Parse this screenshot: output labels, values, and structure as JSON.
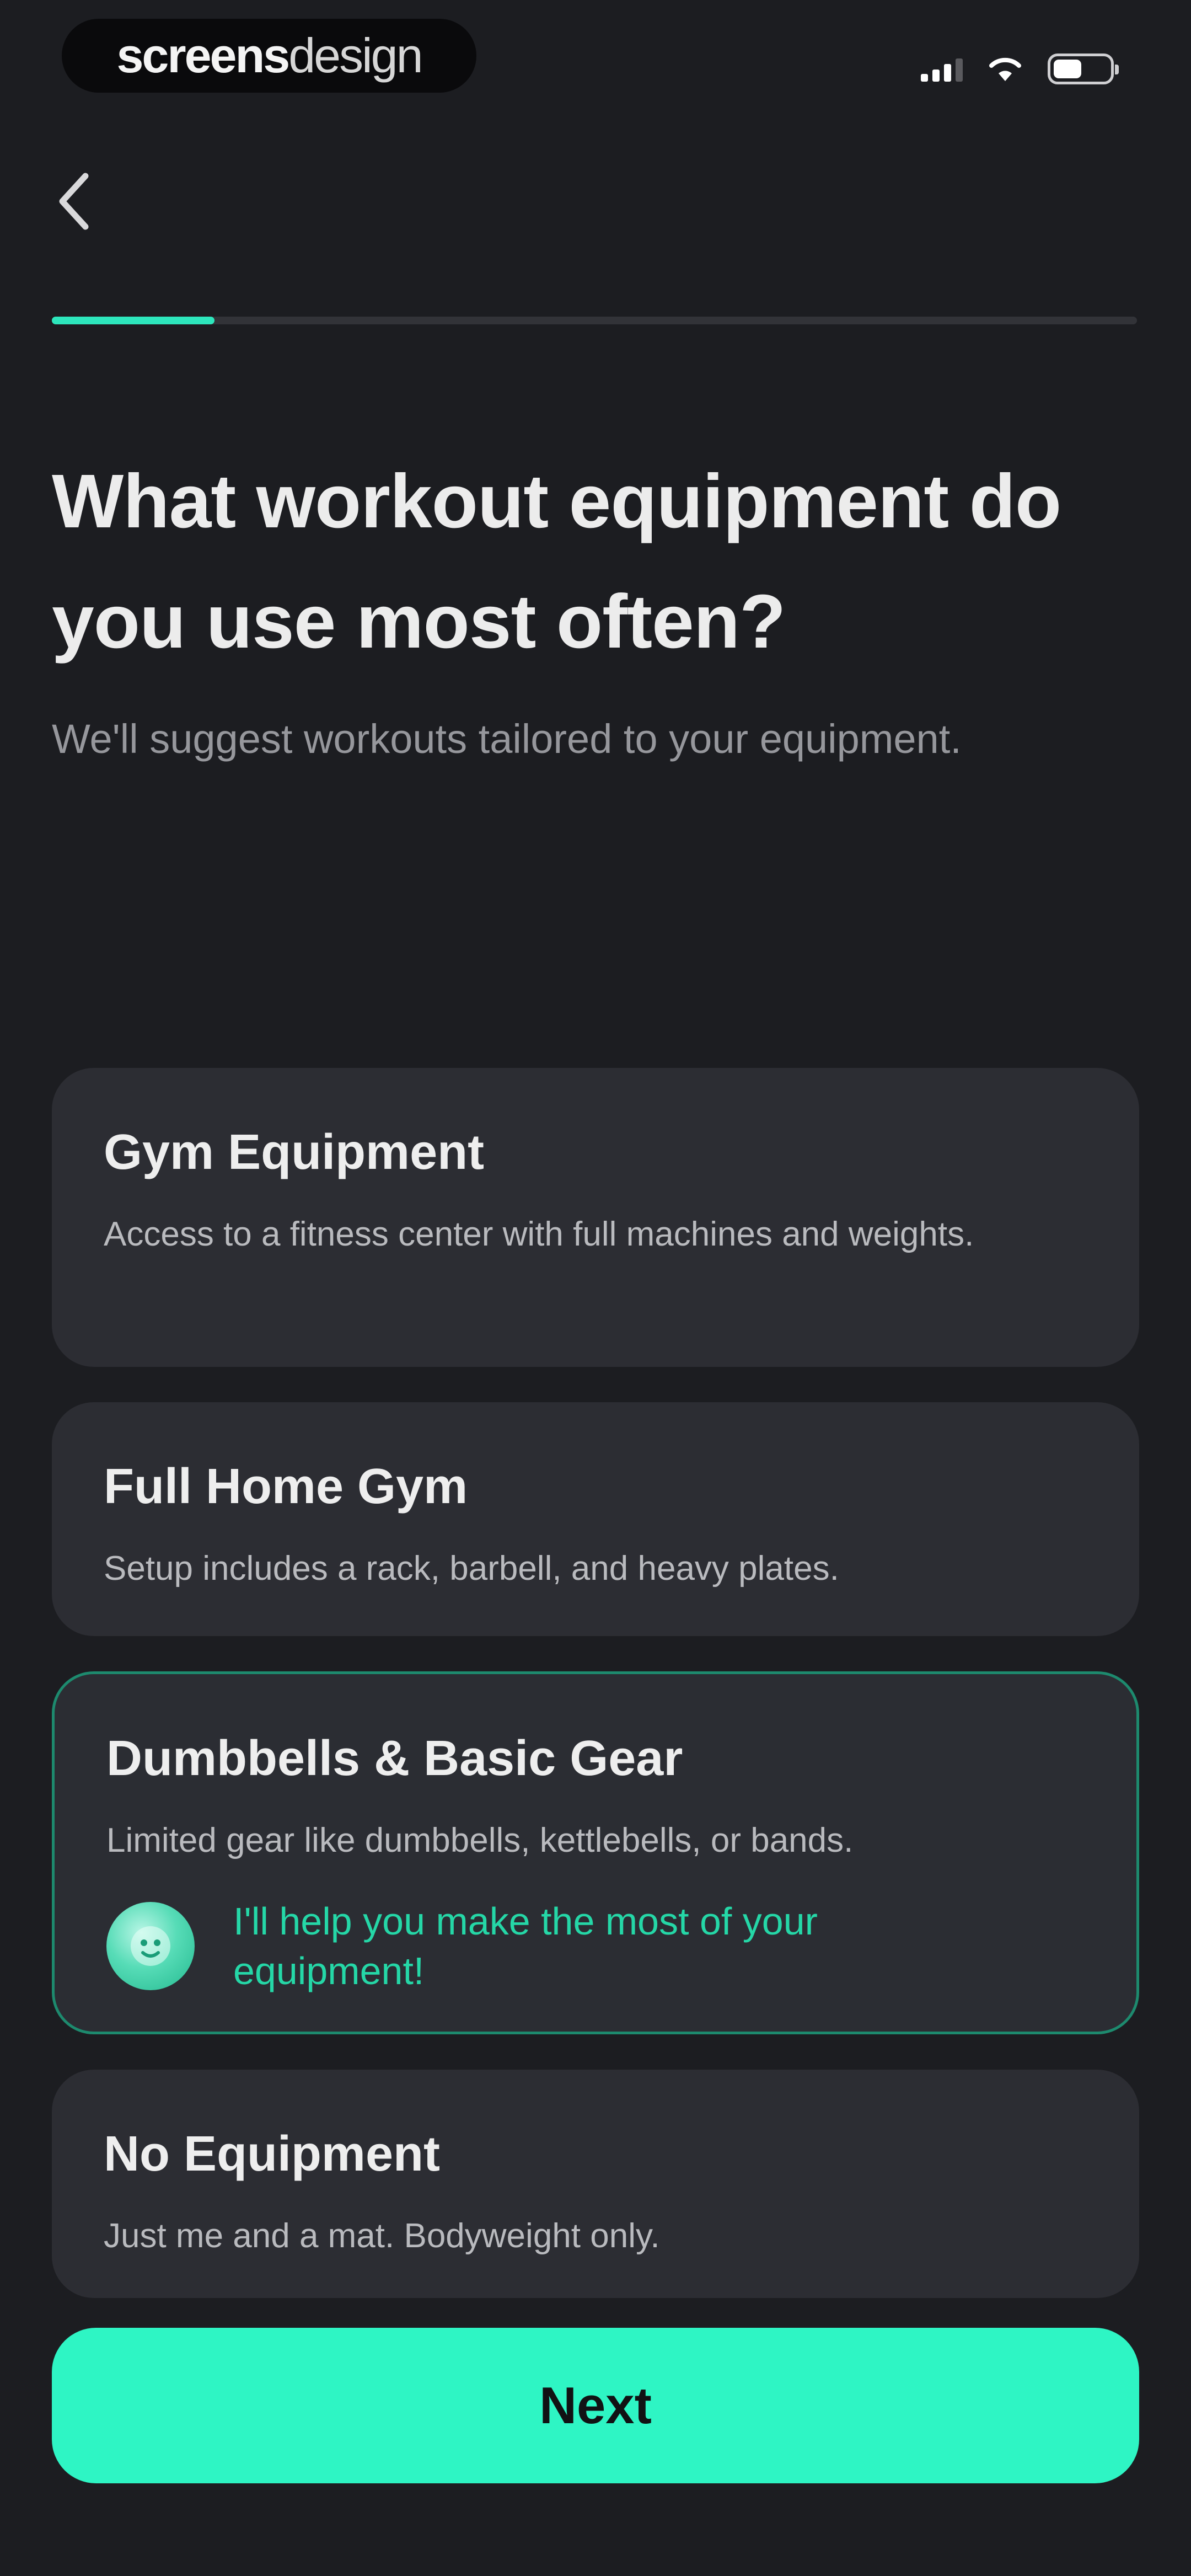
{
  "status_bar": {
    "brand_strong": "screens",
    "brand_light": "design",
    "battery_level_fraction": 0.45
  },
  "nav": {
    "back_icon": "chevron-left-icon"
  },
  "progress": {
    "fraction": 0.15,
    "fill_color": "#2de6bc",
    "track_color": "#323338"
  },
  "header": {
    "title": "What workout equipment do you use most often?",
    "subtitle": "We'll suggest workouts tailored to your equipment."
  },
  "options": [
    {
      "title": "Gym Equipment",
      "description": "Access to a fitness center with full machines and weights.",
      "selected": false
    },
    {
      "title": "Full Home Gym",
      "description": "Setup includes a rack, barbell, and heavy plates.",
      "selected": false
    },
    {
      "title": "Dumbbells & Basic Gear",
      "description": "Limited gear like dumbbells, kettlebells, or bands.",
      "selected": true,
      "hint": "I'll help you make the most of your equipment!"
    },
    {
      "title": "No Equipment",
      "description": "Just me and a mat. Bodyweight only.",
      "selected": false
    }
  ],
  "footer": {
    "next_label": "Next"
  },
  "colors": {
    "background": "#1c1d21",
    "card": "#2c2d33",
    "accent": "#2ef5c4",
    "accent_text": "#25d7a7",
    "selected_border": "#1d8a6e"
  }
}
